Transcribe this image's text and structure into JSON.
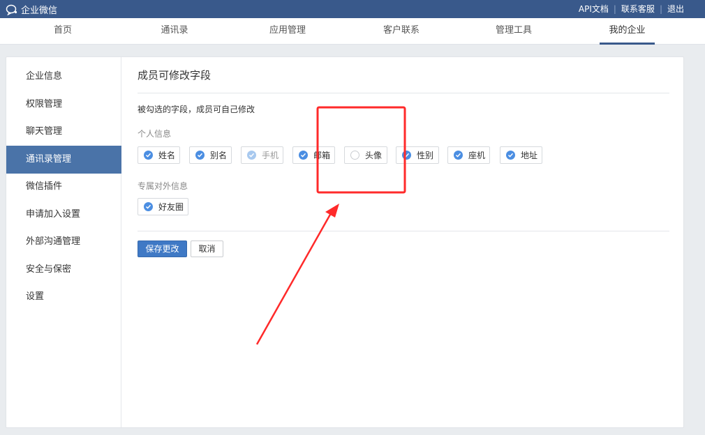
{
  "app": {
    "name": "企业微信"
  },
  "top_links": [
    {
      "label": "API文档"
    },
    {
      "label": "联系客服"
    },
    {
      "label": "退出"
    }
  ],
  "nav": {
    "items": [
      {
        "label": "首页"
      },
      {
        "label": "通讯录"
      },
      {
        "label": "应用管理"
      },
      {
        "label": "客户联系"
      },
      {
        "label": "管理工具"
      },
      {
        "label": "我的企业",
        "active": true
      }
    ]
  },
  "sidebar": {
    "items": [
      {
        "label": "企业信息"
      },
      {
        "label": "权限管理"
      },
      {
        "label": "聊天管理"
      },
      {
        "label": "通讯录管理",
        "active": true
      },
      {
        "label": "微信插件"
      },
      {
        "label": "申请加入设置"
      },
      {
        "label": "外部沟通管理"
      },
      {
        "label": "安全与保密"
      },
      {
        "label": "设置"
      }
    ]
  },
  "main": {
    "title": "成员可修改字段",
    "description": "被勾选的字段，成员可自己修改",
    "personal_section": {
      "label": "个人信息",
      "fields": [
        {
          "label": "姓名",
          "state": "checked"
        },
        {
          "label": "别名",
          "state": "checked"
        },
        {
          "label": "手机",
          "state": "checked-disabled"
        },
        {
          "label": "邮箱",
          "state": "checked"
        },
        {
          "label": "头像",
          "state": "unchecked"
        },
        {
          "label": "性别",
          "state": "checked"
        },
        {
          "label": "座机",
          "state": "checked"
        },
        {
          "label": "地址",
          "state": "checked"
        }
      ]
    },
    "external_section": {
      "label": "专属对外信息",
      "fields": [
        {
          "label": "好友圈",
          "state": "checked"
        }
      ]
    },
    "save_label": "保存更改",
    "cancel_label": "取消"
  },
  "colors": {
    "header_bg": "#39598b",
    "sidebar_active": "#4a73a8",
    "checkbox_on": "#4b8ee2",
    "save_button": "#3f79c5",
    "annotation": "#ff2a2a"
  }
}
